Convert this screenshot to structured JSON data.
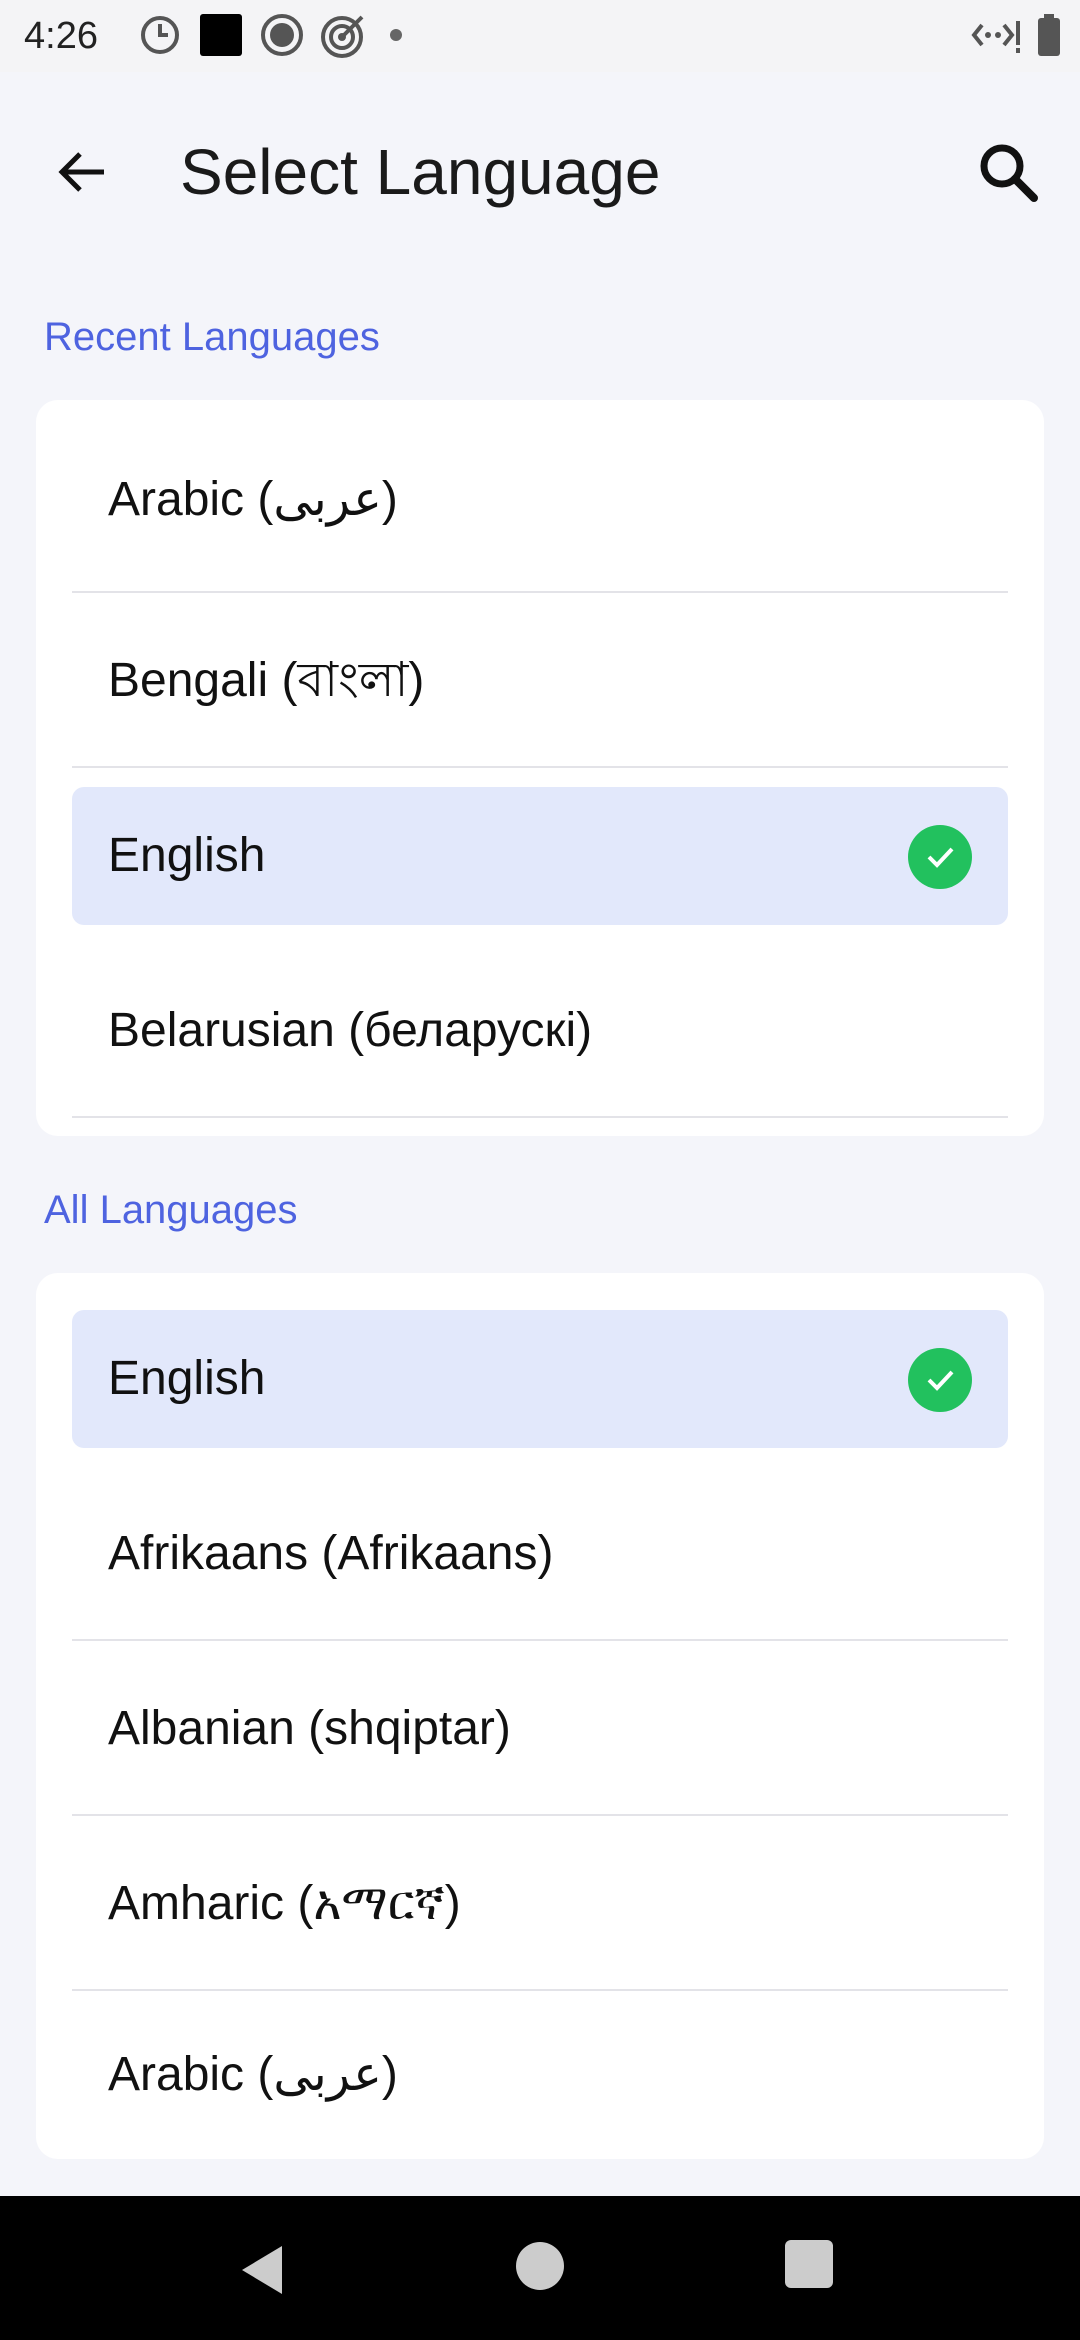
{
  "status_bar": {
    "time": "4:26",
    "left_icons": [
      "do-not-disturb-icon",
      "notification-square-icon",
      "record-icon",
      "target-icon",
      "dot-icon"
    ],
    "right_icons": [
      "data-signal-icon",
      "battery-icon"
    ]
  },
  "app_bar": {
    "title": "Select Language",
    "back_icon": "arrow-left-icon",
    "search_icon": "search-icon"
  },
  "recent_languages": {
    "header": "Recent Languages",
    "items": [
      {
        "label": "Arabic (عربى)",
        "selected": false
      },
      {
        "label": "Bengali (বাংলা)",
        "selected": false
      },
      {
        "label": "English",
        "selected": true
      },
      {
        "label": "Belarusian (беларускі)",
        "selected": false
      }
    ]
  },
  "all_languages": {
    "header": "All Languages",
    "items": [
      {
        "label": "English",
        "selected": true
      },
      {
        "label": "Afrikaans (Afrikaans)",
        "selected": false
      },
      {
        "label": "Albanian (shqiptar)",
        "selected": false
      },
      {
        "label": "Amharic (አማርኛ)",
        "selected": false
      },
      {
        "label": "Arabic (عربى)",
        "selected": false
      }
    ]
  },
  "colors": {
    "accent": "#4e63e0",
    "selected_background": "#e2e8fb",
    "check": "#22c15e",
    "page_background": "#f4f5fa"
  },
  "nav_bar": {
    "icons": [
      "nav-back-icon",
      "nav-home-icon",
      "nav-recents-icon"
    ]
  }
}
